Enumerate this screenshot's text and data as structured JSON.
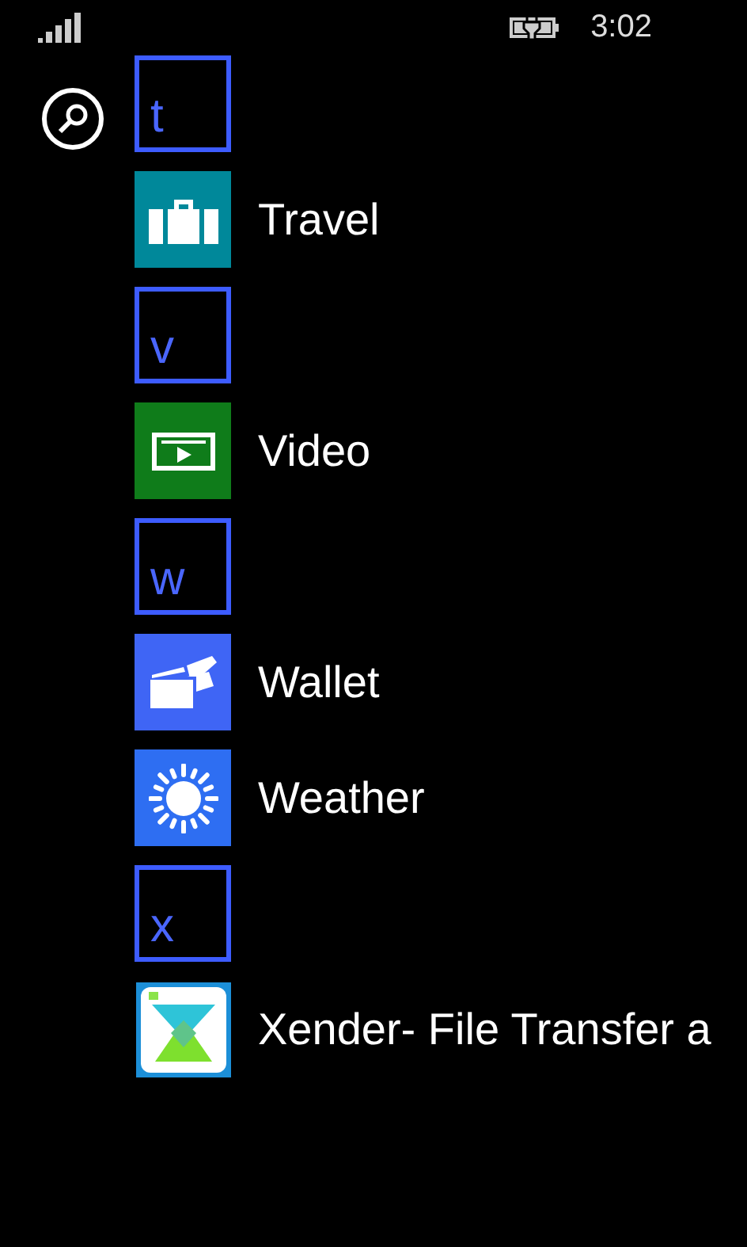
{
  "status_bar": {
    "time": "3:02"
  },
  "items": [
    {
      "kind": "header",
      "letter": "t"
    },
    {
      "kind": "app",
      "label": "Travel",
      "color": "#00889a"
    },
    {
      "kind": "header",
      "letter": "v"
    },
    {
      "kind": "app",
      "label": "Video",
      "color": "#0f7c1a"
    },
    {
      "kind": "header",
      "letter": "w"
    },
    {
      "kind": "app",
      "label": "Wallet",
      "color": "#3f65f5"
    },
    {
      "kind": "app",
      "label": "Weather",
      "color": "#2e6ef2"
    },
    {
      "kind": "header",
      "letter": "x"
    },
    {
      "kind": "picture_app",
      "label": "Xender- File Transfer a"
    }
  ]
}
